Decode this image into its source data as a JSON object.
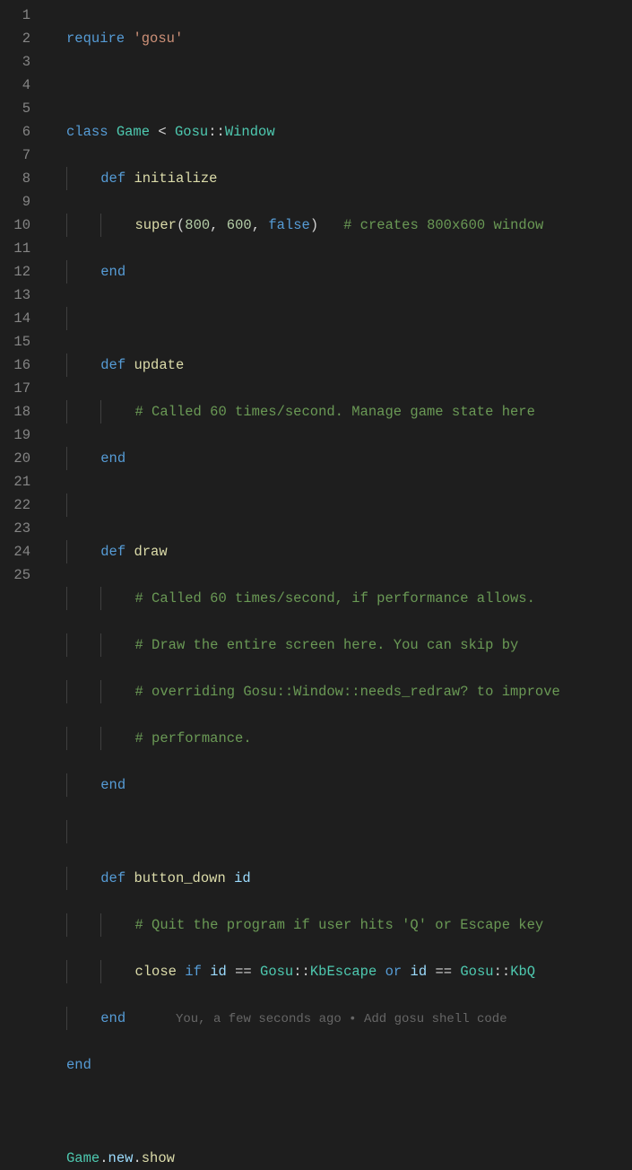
{
  "line_numbers": [
    "1",
    "2",
    "3",
    "4",
    "5",
    "6",
    "7",
    "8",
    "9",
    "10",
    "11",
    "12",
    "13",
    "14",
    "15",
    "16",
    "17",
    "18",
    "19",
    "20",
    "21",
    "22",
    "23",
    "24",
    "25"
  ],
  "codelens": "You, a few seconds ago • Add gosu shell code",
  "code": {
    "l1": {
      "require": "require",
      "sp": " ",
      "gosu_str": "'gosu'"
    },
    "l3": {
      "class": "class",
      "sp": " ",
      "Game": "Game",
      "sp2": " ",
      "lt": "<",
      "sp3": " ",
      "Gosu": "Gosu",
      "cc": "::",
      "Window": "Window"
    },
    "l4": {
      "def": "def",
      "sp": " ",
      "initialize": "initialize"
    },
    "l5": {
      "super": "super",
      "lp": "(",
      "n800": "800",
      "c1": ",",
      "sp": " ",
      "n600": "600",
      "c2": ",",
      "sp2": " ",
      "false": "false",
      "rp": ")",
      "pad": "   ",
      "cmt": "# creates 800x600 window"
    },
    "l6": {
      "end": "end"
    },
    "l8": {
      "def": "def",
      "sp": " ",
      "update": "update"
    },
    "l9": {
      "cmt": "# Called 60 times/second. Manage game state here"
    },
    "l10": {
      "end": "end"
    },
    "l12": {
      "def": "def",
      "sp": " ",
      "draw": "draw"
    },
    "l13": {
      "cmt": "# Called 60 times/second, if performance allows."
    },
    "l14": {
      "cmt": "# Draw the entire screen here. You can skip by"
    },
    "l15": {
      "cmt": "# overriding Gosu::Window::needs_redraw? to improve"
    },
    "l16": {
      "cmt": "# performance."
    },
    "l17": {
      "end": "end"
    },
    "l19": {
      "def": "def",
      "sp": " ",
      "button_down": "button_down",
      "sp2": " ",
      "id": "id"
    },
    "l20": {
      "cmt": "# Quit the program if user hits 'Q' or Escape key"
    },
    "l21": {
      "close": "close",
      "sp": " ",
      "if": "if",
      "sp2": " ",
      "id": "id",
      "sp3": " ",
      "eq": "==",
      "sp4": " ",
      "Gosu": "Gosu",
      "cc": "::",
      "KbEscape": "KbEscape",
      "sp5": " ",
      "or": "or",
      "sp6": " ",
      "id2": "id",
      "sp7": " ",
      "eq2": "==",
      "sp8": " ",
      "Gosu2": "Gosu",
      "cc2": "::",
      "KbQ": "KbQ"
    },
    "l22": {
      "end": "end"
    },
    "l23": {
      "end": "end"
    },
    "l25": {
      "Game": "Game",
      "d1": ".",
      "new": "new",
      "d2": ".",
      "show": "show"
    }
  }
}
